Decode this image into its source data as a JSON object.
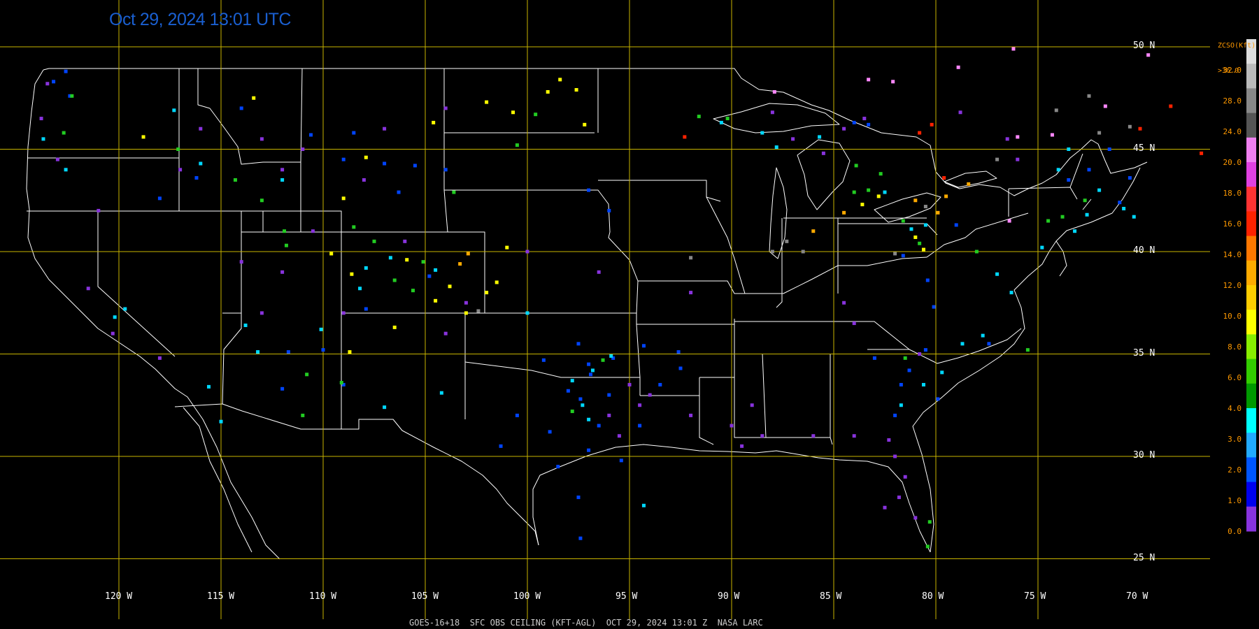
{
  "timestamp": "Oct 29, 2024 13:01 UTC",
  "footer": "GOES-16+18  SFC OBS CEILING (KFT-AGL)  OCT 29, 2024 13:01 Z  NASA LARC",
  "legend": {
    "title_line1": "ZCSO(Kft)",
    "title_line2": ">36.0",
    "labels": [
      "32.0",
      "28.0",
      "24.0",
      "20.0",
      "18.0",
      "16.0",
      "14.0",
      "12.0",
      "10.0",
      "8.0",
      "6.0",
      "4.0",
      "3.0",
      "2.0",
      "1.0",
      "0.0"
    ],
    "colors": [
      "#dddddd",
      "#bbbbbb",
      "#888888",
      "#555555",
      "#f080f0",
      "#e040e0",
      "#ff3333",
      "#ff2200",
      "#ff7700",
      "#ffaa00",
      "#ffcc00",
      "#ffff00",
      "#88ee00",
      "#33cc00",
      "#009900",
      "#00ffff",
      "#22aaff",
      "#0055ff",
      "#0000ee",
      "#8833dd"
    ]
  },
  "latitudes": [
    "50 N",
    "45 N",
    "40 N",
    "35 N",
    "30 N",
    "25 N"
  ],
  "longitudes": [
    "120 W",
    "115 W",
    "110 W",
    "105 W",
    "100 W",
    "95 W",
    "90 W",
    "85 W",
    "80 W",
    "75 W",
    "70 W"
  ],
  "colors": {
    "grid": "#c8b400",
    "border": "#ffffff",
    "timestamp": "#1a5fd0",
    "legend_text": "#ff9900"
  },
  "observations": {
    "purple": [
      [
        -123.5,
        48.2
      ],
      [
        -123.8,
        46.5
      ],
      [
        -123,
        44.5
      ],
      [
        -121,
        42
      ],
      [
        -117,
        44
      ],
      [
        -116,
        46
      ],
      [
        -113,
        45.5
      ],
      [
        -112,
        44
      ],
      [
        -111,
        45
      ],
      [
        -108,
        43.5
      ],
      [
        -107,
        46
      ],
      [
        -104,
        47
      ],
      [
        -100,
        40
      ],
      [
        -96.5,
        39
      ],
      [
        -92,
        38
      ],
      [
        -94,
        33
      ],
      [
        -92,
        32
      ],
      [
        -90,
        31.5
      ],
      [
        -89.5,
        30.5
      ],
      [
        -89,
        32.5
      ],
      [
        -88.5,
        31
      ],
      [
        -82.3,
        30.8
      ],
      [
        -82,
        30
      ],
      [
        -81.5,
        29
      ],
      [
        -81.8,
        28
      ],
      [
        -82.5,
        27.5
      ],
      [
        -81,
        27
      ],
      [
        -84,
        31
      ],
      [
        -86,
        31
      ],
      [
        -85.5,
        44.8
      ],
      [
        -87,
        45.5
      ],
      [
        -84.5,
        46
      ],
      [
        -88,
        46.8
      ],
      [
        -83.5,
        46.5
      ],
      [
        -120.3,
        36
      ],
      [
        -118,
        34.8
      ],
      [
        -121.5,
        38.2
      ],
      [
        -96,
        32
      ],
      [
        -95.5,
        31
      ],
      [
        -94.5,
        32.5
      ],
      [
        -95,
        33.5
      ],
      [
        -80.8,
        35
      ],
      [
        -84,
        36.5
      ],
      [
        -84.5,
        37.5
      ],
      [
        -78.8,
        46.8
      ],
      [
        -76.5,
        45.5
      ],
      [
        -76,
        44.5
      ],
      [
        -110.5,
        41
      ],
      [
        -112,
        39
      ],
      [
        -113,
        37
      ],
      [
        -114,
        39.5
      ],
      [
        -109,
        37
      ],
      [
        -106,
        40.5
      ],
      [
        -104,
        36
      ],
      [
        -103,
        37.5
      ]
    ],
    "blue": [
      [
        -123.2,
        48.3
      ],
      [
        -122.4,
        47.6
      ],
      [
        -122.6,
        48.8
      ],
      [
        -118,
        42.6
      ],
      [
        -116.2,
        43.6
      ],
      [
        -114,
        47
      ],
      [
        -110.6,
        45.7
      ],
      [
        -109,
        44.5
      ],
      [
        -108.5,
        45.8
      ],
      [
        -107,
        44.3
      ],
      [
        -106.3,
        42.9
      ],
      [
        -105.5,
        44.2
      ],
      [
        -104,
        44
      ],
      [
        -97,
        43
      ],
      [
        -96,
        42
      ],
      [
        -99.2,
        34.7
      ],
      [
        -97.5,
        35.5
      ],
      [
        -96.9,
        34
      ],
      [
        -96,
        33
      ],
      [
        -97.4,
        32.8
      ],
      [
        -96.5,
        31.5
      ],
      [
        -97,
        30.3
      ],
      [
        -98.5,
        29.5
      ],
      [
        -97.5,
        28
      ],
      [
        -97.4,
        26
      ],
      [
        -95.4,
        29.8
      ],
      [
        -94.5,
        31.5
      ],
      [
        -93.5,
        33.5
      ],
      [
        -92.6,
        35.1
      ],
      [
        -94.3,
        35.4
      ],
      [
        -97,
        34.5
      ],
      [
        -98,
        33.2
      ],
      [
        -95.8,
        34.8
      ],
      [
        -100.5,
        32
      ],
      [
        -101.3,
        30.5
      ],
      [
        -98.9,
        31.2
      ],
      [
        -92.5,
        34.3
      ],
      [
        -81.6,
        39.8
      ],
      [
        -80.4,
        38.6
      ],
      [
        -79,
        41.3
      ],
      [
        -80.1,
        37.3
      ],
      [
        -80.5,
        35.2
      ],
      [
        -81.7,
        33.5
      ],
      [
        -82,
        32
      ],
      [
        -79.9,
        32.8
      ],
      [
        -81.3,
        34.2
      ],
      [
        -83,
        34.8
      ],
      [
        -77.4,
        35.5
      ],
      [
        -84,
        46.3
      ],
      [
        -83.3,
        46.2
      ],
      [
        -71,
        42.4
      ],
      [
        -70.5,
        43.6
      ],
      [
        -73.5,
        43.5
      ],
      [
        -72.5,
        44
      ],
      [
        -71.5,
        45
      ],
      [
        -109,
        33.5
      ],
      [
        -112,
        33.3
      ],
      [
        -110,
        35.2
      ],
      [
        -111.7,
        35.1
      ],
      [
        -107.9,
        37.2
      ],
      [
        -104.8,
        38.8
      ]
    ],
    "lightblue": [
      [
        -123.7,
        45.5
      ],
      [
        -122.6,
        44
      ],
      [
        -120.2,
        36.8
      ],
      [
        -119.7,
        37.2
      ],
      [
        -117.3,
        46.9
      ],
      [
        -116,
        44.3
      ],
      [
        -112,
        43.5
      ],
      [
        -108.2,
        38.2
      ],
      [
        -107.9,
        39.2
      ],
      [
        -106.7,
        39.7
      ],
      [
        -104.5,
        39.1
      ],
      [
        -100,
        37
      ],
      [
        -97.8,
        33.7
      ],
      [
        -97.3,
        32.5
      ],
      [
        -97,
        31.8
      ],
      [
        -95.9,
        34.9
      ],
      [
        -96.8,
        34.2
      ],
      [
        -90.5,
        46.3
      ],
      [
        -88.5,
        45.8
      ],
      [
        -87.8,
        45.1
      ],
      [
        -85.7,
        45.6
      ],
      [
        -82.5,
        42.9
      ],
      [
        -80.5,
        41.3
      ],
      [
        -81.2,
        41.1
      ],
      [
        -77,
        38.9
      ],
      [
        -76.3,
        38
      ],
      [
        -77.7,
        35.9
      ],
      [
        -78.7,
        35.5
      ],
      [
        -79.7,
        34.1
      ],
      [
        -80.6,
        33.5
      ],
      [
        -81.7,
        32.5
      ],
      [
        -74.8,
        40.2
      ],
      [
        -73.2,
        41
      ],
      [
        -70.3,
        41.7
      ],
      [
        -70.8,
        42.1
      ],
      [
        -72.6,
        41.8
      ],
      [
        -72,
        43
      ],
      [
        -74,
        44
      ],
      [
        -73.5,
        45
      ],
      [
        -94.3,
        27.6
      ],
      [
        -104.2,
        33.1
      ],
      [
        -107,
        32.4
      ],
      [
        -110.1,
        36.2
      ],
      [
        -113.8,
        36.4
      ],
      [
        -113.2,
        35.1
      ],
      [
        -115.6,
        33.4
      ],
      [
        -115,
        31.7
      ]
    ],
    "green": [
      [
        -122.3,
        47.6
      ],
      [
        -122.7,
        45.8
      ],
      [
        -117.1,
        45
      ],
      [
        -114.3,
        43.5
      ],
      [
        -113,
        42.5
      ],
      [
        -111.9,
        41
      ],
      [
        -111.8,
        40.3
      ],
      [
        -108.5,
        41.2
      ],
      [
        -107.5,
        40.5
      ],
      [
        -106.5,
        38.6
      ],
      [
        -105.6,
        38.1
      ],
      [
        -105.1,
        39.5
      ],
      [
        -103.6,
        42.9
      ],
      [
        -100.5,
        45.2
      ],
      [
        -99.6,
        46.7
      ],
      [
        -96.3,
        34.7
      ],
      [
        -97.8,
        32.2
      ],
      [
        -91.6,
        46.6
      ],
      [
        -90.2,
        46.5
      ],
      [
        -83.9,
        44.2
      ],
      [
        -82.7,
        43.8
      ],
      [
        -83.3,
        43
      ],
      [
        -84,
        42.9
      ],
      [
        -81.6,
        41.5
      ],
      [
        -80.8,
        40.4
      ],
      [
        -78,
        40
      ],
      [
        -73.8,
        41.7
      ],
      [
        -74.5,
        41.5
      ],
      [
        -72.7,
        42.5
      ],
      [
        -75.5,
        35.2
      ],
      [
        -80.3,
        26.8
      ],
      [
        -80.4,
        25.6
      ],
      [
        -81.5,
        34.8
      ],
      [
        -110.8,
        34
      ],
      [
        -111,
        32
      ],
      [
        -109.1,
        33.6
      ]
    ],
    "yellow": [
      [
        -118.8,
        45.6
      ],
      [
        -113.4,
        47.5
      ],
      [
        -109,
        42.6
      ],
      [
        -107.9,
        44.6
      ],
      [
        -104.6,
        46.3
      ],
      [
        -102,
        47.3
      ],
      [
        -100.7,
        46.8
      ],
      [
        -99,
        47.8
      ],
      [
        -97.6,
        47.9
      ],
      [
        -98.4,
        48.4
      ],
      [
        -97.2,
        46.2
      ],
      [
        -104.5,
        37.6
      ],
      [
        -103.8,
        38.3
      ],
      [
        -103,
        37
      ],
      [
        -102,
        38
      ],
      [
        -101.5,
        38.5
      ],
      [
        -101,
        40.2
      ],
      [
        -108.6,
        38.9
      ],
      [
        -109.6,
        39.9
      ],
      [
        -82.8,
        42.7
      ],
      [
        -83.6,
        42.3
      ],
      [
        -81,
        40.7
      ],
      [
        -80.6,
        40.1
      ],
      [
        -105.9,
        39.6
      ],
      [
        -106.5,
        36.3
      ],
      [
        -108.7,
        35.1
      ]
    ],
    "orange": [
      [
        -81,
        42.5
      ],
      [
        -79.9,
        41.9
      ],
      [
        -78.4,
        43.3
      ],
      [
        -79.5,
        42.7
      ],
      [
        -102.9,
        39.9
      ],
      [
        -103.3,
        39.4
      ],
      [
        -86,
        41
      ],
      [
        -84.5,
        41.9
      ]
    ],
    "red": [
      [
        -92.3,
        45.6
      ],
      [
        -80.8,
        45.8
      ],
      [
        -80.2,
        46.2
      ],
      [
        -79.6,
        43.6
      ],
      [
        -70,
        46
      ],
      [
        -68.5,
        47.1
      ],
      [
        -67,
        44.8
      ]
    ],
    "pink": [
      [
        -87.9,
        47.8
      ],
      [
        -83.3,
        48.4
      ],
      [
        -82.1,
        48.3
      ],
      [
        -76,
        45.6
      ],
      [
        -74.3,
        45.7
      ],
      [
        -78.9,
        49
      ],
      [
        -76.2,
        49.9
      ],
      [
        -69.6,
        49.6
      ],
      [
        -71.7,
        47.1
      ],
      [
        -76.4,
        41.5
      ]
    ],
    "gray": [
      [
        -102.4,
        37.1
      ],
      [
        -92,
        39.7
      ],
      [
        -88,
        40
      ],
      [
        -87.3,
        40.5
      ],
      [
        -86.5,
        40
      ],
      [
        -82,
        39.9
      ],
      [
        -80.5,
        42.2
      ],
      [
        -77,
        44.5
      ],
      [
        -72,
        45.8
      ],
      [
        -70.5,
        46.1
      ],
      [
        -72.5,
        47.6
      ],
      [
        -74.1,
        46.9
      ]
    ]
  }
}
